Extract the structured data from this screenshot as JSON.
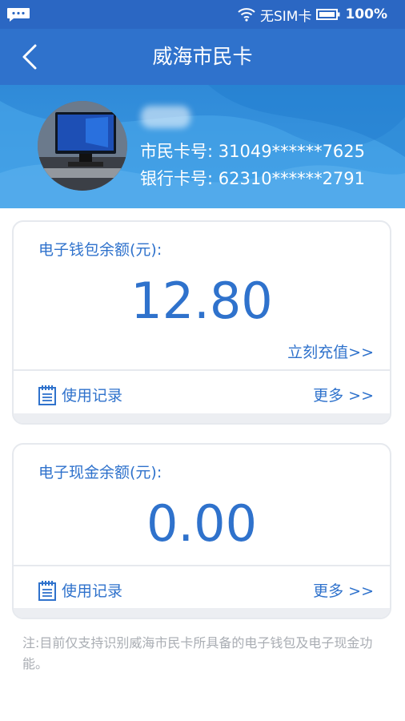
{
  "status_bar": {
    "network": "无SIM卡",
    "battery": "100%"
  },
  "header": {
    "title": "威海市民卡"
  },
  "profile": {
    "citizen_card_label": "市民卡号:",
    "citizen_card_number": "31049******7625",
    "bank_card_label": "银行卡号:",
    "bank_card_number": "62310******2791"
  },
  "e_wallet": {
    "label": "电子钱包余额(元):",
    "amount": "12.80",
    "recharge": "立刻充值>>",
    "records": "使用记录",
    "more": "更多 >>"
  },
  "e_cash": {
    "label": "电子现金余额(元):",
    "amount": "0.00",
    "records": "使用记录",
    "more": "更多 >>"
  },
  "footer_note": "注:目前仅支持识别威海市民卡所具备的电子钱包及电子现金功能。",
  "colors": {
    "primary": "#2f72cc",
    "status_bar": "#2b67c3",
    "muted_text": "#a9adb3"
  }
}
